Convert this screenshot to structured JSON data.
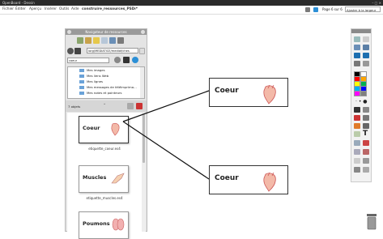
{
  "window": {
    "title": "OpenBoard - Dessin",
    "controls": "– □ ×"
  },
  "menubar": {
    "items": [
      "Fichier",
      "Éditer",
      "Aperçu",
      "Insérer",
      "Outils",
      "Aide"
    ],
    "document_tab": "construire_ressources_PSD *",
    "page_label": "Page 6 sur 6",
    "zoom_select": "Ajuster à la largeur"
  },
  "navigator": {
    "title": "Navigateur de ressources",
    "path_value": "lorg/MEDIATICE/mediaf/ches",
    "search_value": "coeur",
    "tree_items": [
      "Mes images",
      "Mes liens Web",
      "Mes lignes",
      "Mes messages de téléimprima…",
      "Mes notes et pointeurs"
    ],
    "section_label": "7 objets",
    "thumbnails": [
      {
        "label": "Coeur",
        "filename": "etiquette_coeur.es4"
      },
      {
        "label": "Muscles",
        "filename": "etiquette_muscles.es4"
      },
      {
        "label": "Poumons",
        "filename": ""
      }
    ]
  },
  "canvas": {
    "cards": [
      {
        "label": "Coeur"
      },
      {
        "label": "Coeur"
      }
    ]
  },
  "toolbar": {
    "palette_colors": [
      "#000000",
      "#ffffff",
      "#ff0000",
      "#ffa500",
      "#ffff00",
      "#00b050",
      "#00b0f0",
      "#0000ff",
      "#ff00ff",
      "#808080"
    ]
  },
  "colors": {
    "accent": "#2c8fd6",
    "panel_header": "#9a9a9a",
    "titlebar": "#2b2b2b"
  }
}
